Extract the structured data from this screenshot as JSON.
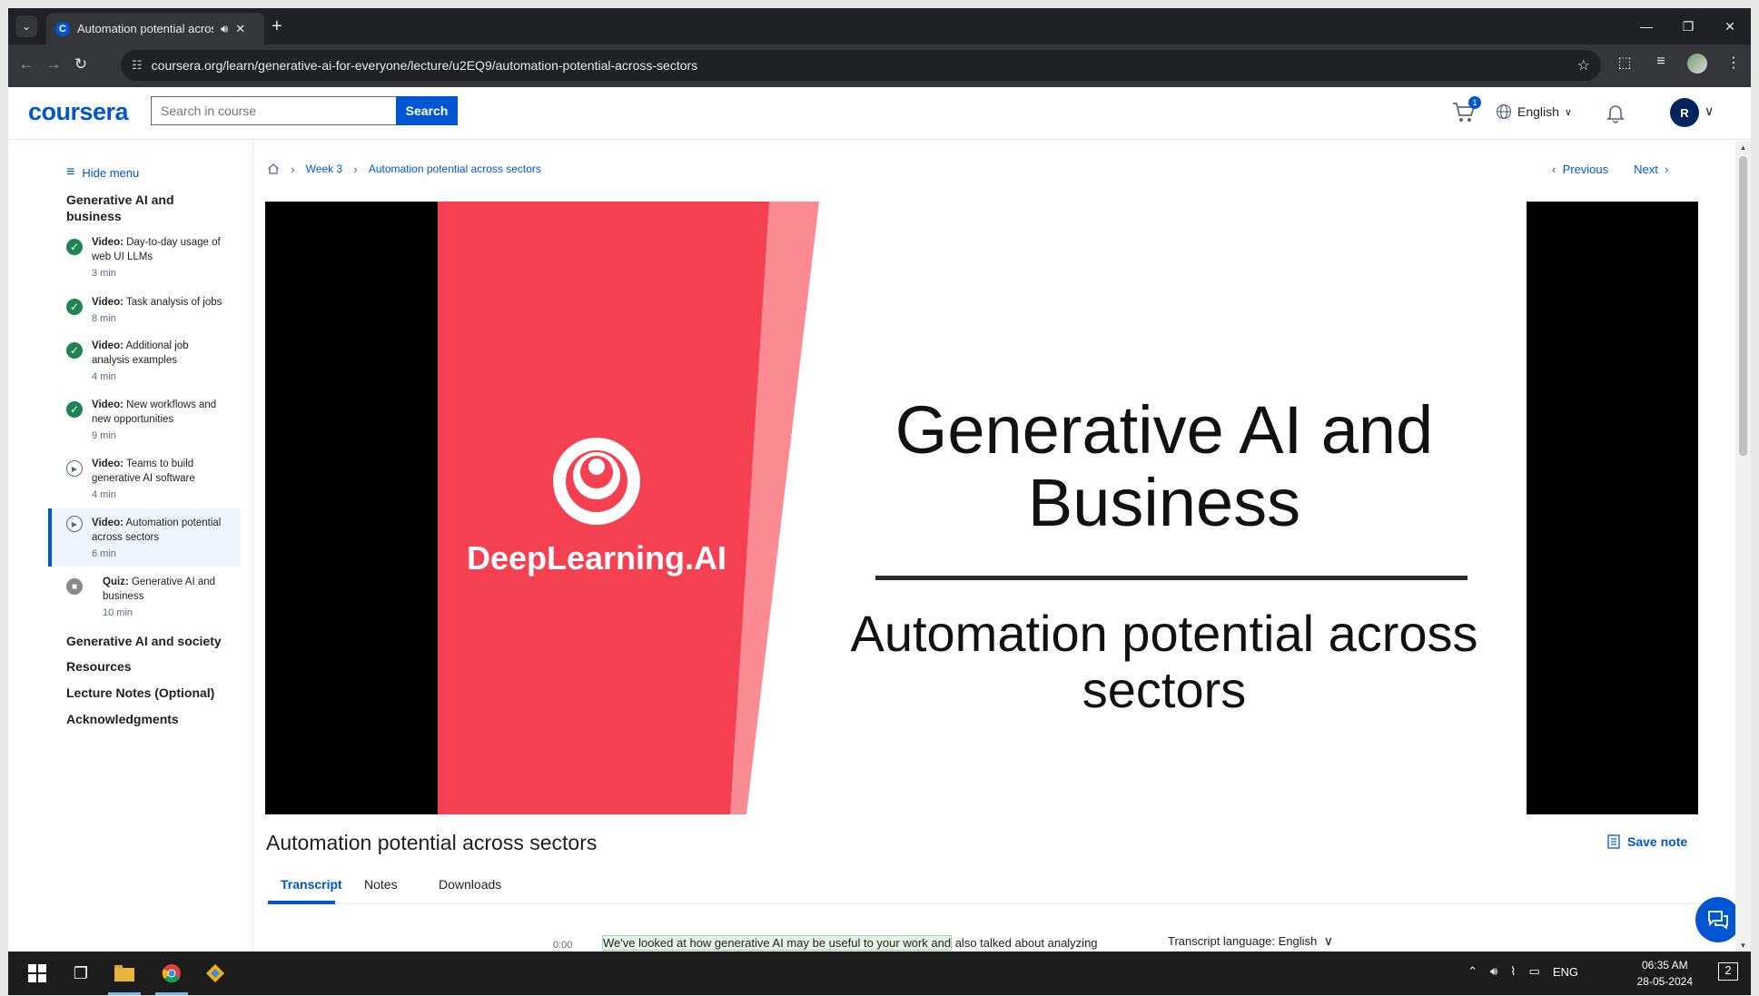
{
  "browser": {
    "tab_title": "Automation potential acros",
    "url": "coursera.org/learn/generative-ai-for-everyone/lecture/u2EQ9/automation-potential-across-sectors"
  },
  "header": {
    "logo": "coursera",
    "search_placeholder": "Search in course",
    "search_label": "Search",
    "cart_count": "1",
    "language": "English",
    "avatar_initial": "R"
  },
  "sidebar": {
    "hide_menu": "Hide menu",
    "section_title": "Generative AI and business",
    "items": [
      {
        "kind": "Video:",
        "title": "Day-to-day usage of web UI LLMs",
        "duration": "3 min",
        "status": "completed"
      },
      {
        "kind": "Video:",
        "title": "Task analysis of jobs",
        "duration": "8 min",
        "status": "completed"
      },
      {
        "kind": "Video:",
        "title": "Additional job analysis examples",
        "duration": "4 min",
        "status": "completed"
      },
      {
        "kind": "Video:",
        "title": "New workflows and new opportunities",
        "duration": "9 min",
        "status": "completed"
      },
      {
        "kind": "Video:",
        "title": "Teams to build generative AI software",
        "duration": "4 min",
        "status": "not-started"
      },
      {
        "kind": "Video:",
        "title": "Automation potential across sectors",
        "duration": "6 min",
        "status": "current"
      },
      {
        "kind": "Quiz:",
        "title": "Generative AI and business",
        "duration": "10 min",
        "status": "locked"
      }
    ],
    "other_sections": [
      "Generative AI and society",
      "Resources",
      "Lecture Notes (Optional)",
      "Acknowledgments"
    ]
  },
  "breadcrumb": {
    "week": "Week 3",
    "lecture": "Automation potential across sectors"
  },
  "nav": {
    "previous": "Previous",
    "next": "Next"
  },
  "slide": {
    "brand": "DeepLearning.AI",
    "title": "Generative AI and Business",
    "subtitle": "Automation potential across sectors"
  },
  "lecture": {
    "title": "Automation potential across sectors",
    "save_note": "Save note",
    "tabs": [
      "Transcript",
      "Notes",
      "Downloads"
    ],
    "active_tab": "Transcript"
  },
  "transcript": {
    "timestamp": "0:00",
    "highlighted_text": "We've looked at how generative AI may be useful to your work and",
    "rest_text": "also talked about analyzing",
    "language_label": "Transcript language:",
    "language_value": "English"
  },
  "taskbar": {
    "lang": "ENG",
    "time": "06:35 AM",
    "date": "28-05-2024",
    "notifications": "2"
  },
  "colors": {
    "brand_blue": "#0056d2",
    "slide_red": "#f44050",
    "completed_green": "#1f8354"
  }
}
